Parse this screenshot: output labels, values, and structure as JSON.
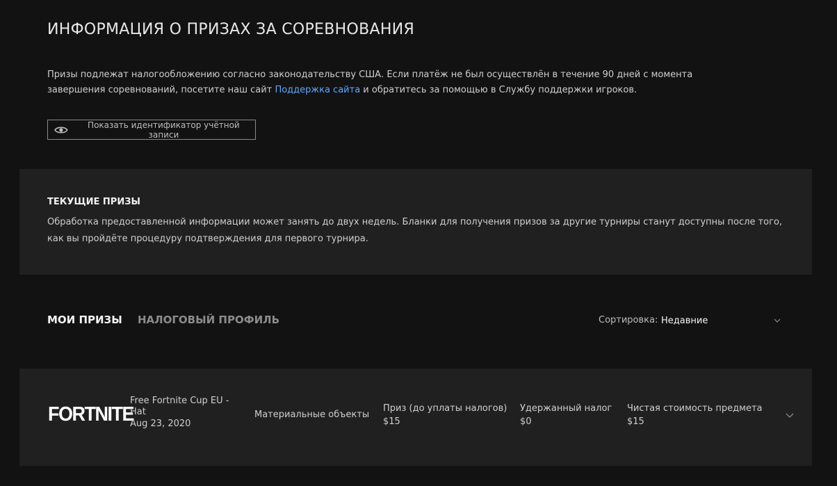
{
  "header": {
    "title": "ИНФОРМАЦИЯ О ПРИЗАХ ЗА СОРЕВНОВАНИЯ"
  },
  "info": {
    "text_before": "Призы подлежат налогообложению согласно законодательству США. Если платёж не был осуществлён в течение 90 дней с момента завершения соревнований, посетите наш сайт ",
    "link_label": "Поддержка сайта",
    "text_after": " и обратитесь за помощью в Службу поддержки игроков."
  },
  "show_id_button": {
    "label": "Показать идентификатор учётной записи",
    "icon": "eye-icon"
  },
  "current_prizes": {
    "title": "ТЕКУЩИЕ ПРИЗЫ",
    "text": "Обработка предоставленной информации может занять до двух недель. Бланки для получения призов за другие турниры станут доступны после того, как вы пройдёте процедуру подтверждения для первого турнира."
  },
  "tabs": [
    {
      "label": "МОИ ПРИЗЫ",
      "active": true
    },
    {
      "label": "НАЛОГОВЫЙ ПРОФИЛЬ",
      "active": false
    }
  ],
  "sort": {
    "label": "Сортировка:",
    "value": "Недавние",
    "icon": "chevron-down-icon"
  },
  "prizes": [
    {
      "logo": "FORTNITE",
      "name": "Free Fortnite Cup EU - Hat",
      "date": "Aug 23, 2020",
      "type": "Материальные объекты",
      "prize_label": "Приз (до уплаты налогов)",
      "prize_value": "$15",
      "tax_label": "Удержанный налог",
      "tax_value": "$0",
      "net_label": "Чистая стоимость предмета",
      "net_value": "$15",
      "icon": "chevron-down-icon"
    }
  ],
  "colors": {
    "background": "#121212",
    "panel": "#202020",
    "link": "#5fa8ff"
  }
}
